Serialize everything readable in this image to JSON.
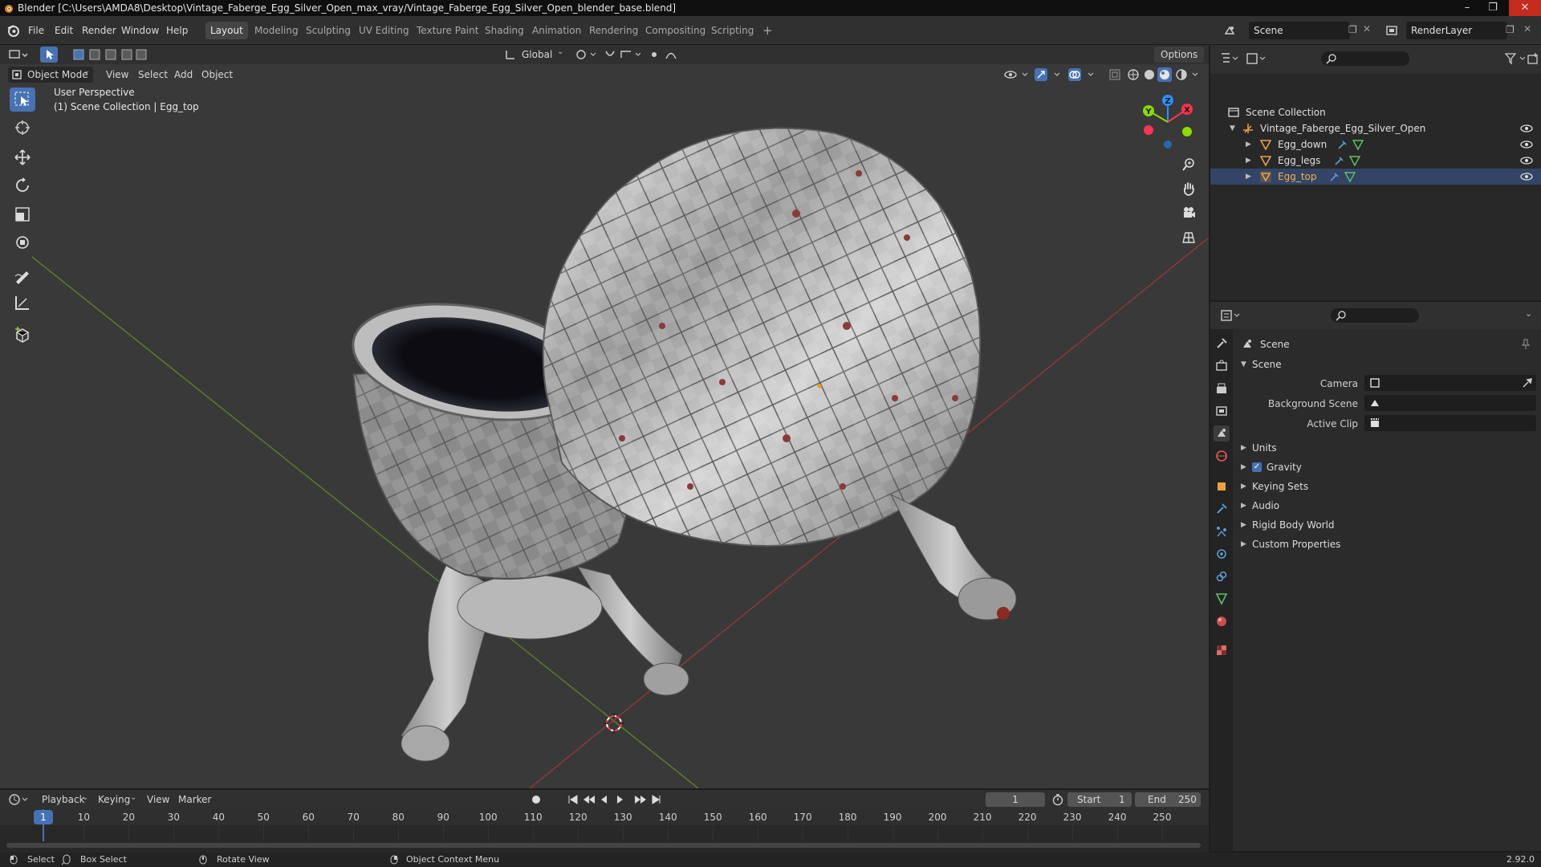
{
  "window": {
    "title": "Blender [C:\\Users\\AMDA8\\Desktop\\Vintage_Faberge_Egg_Silver_Open_max_vray/Vintage_Faberge_Egg_Silver_Open_blender_base.blend]"
  },
  "menu": [
    "File",
    "Edit",
    "Render",
    "Window",
    "Help"
  ],
  "workspaces": [
    {
      "label": "Layout",
      "active": true
    },
    {
      "label": "Modeling"
    },
    {
      "label": "Sculpting"
    },
    {
      "label": "UV Editing"
    },
    {
      "label": "Texture Paint"
    },
    {
      "label": "Shading"
    },
    {
      "label": "Animation"
    },
    {
      "label": "Rendering"
    },
    {
      "label": "Compositing"
    },
    {
      "label": "Scripting"
    }
  ],
  "add_workspace": "+",
  "scene_selector": {
    "value": "Scene"
  },
  "view_layer_selector": {
    "value": "RenderLayer"
  },
  "viewport": {
    "mode": "Object Mode",
    "menus": [
      "View",
      "Select",
      "Add",
      "Object"
    ],
    "transform_orientation": "Global",
    "options_label": "Options",
    "overlay_title": "User Perspective",
    "overlay_subtitle": "(1) Scene Collection | Egg_top",
    "gizmo_axes": {
      "x": "X",
      "y": "Y",
      "z": "Z"
    }
  },
  "outliner": {
    "root": "Scene Collection",
    "collection": "Vintage_Faberge_Egg_Silver_Open",
    "objects": [
      "Egg_down",
      "Egg_legs",
      "Egg_top"
    ]
  },
  "properties": {
    "context_title": "Scene",
    "panel_title": "Scene",
    "fields": [
      {
        "label": "Camera",
        "value": ""
      },
      {
        "label": "Background Scene",
        "value": ""
      },
      {
        "label": "Active Clip",
        "value": ""
      }
    ],
    "subpanels": [
      {
        "label": "Units"
      },
      {
        "label": "Gravity",
        "checkbox": true
      },
      {
        "label": "Keying Sets"
      },
      {
        "label": "Audio"
      },
      {
        "label": "Rigid Body World"
      },
      {
        "label": "Custom Properties"
      }
    ]
  },
  "timeline": {
    "menus": [
      "Playback",
      "Keying",
      "View",
      "Marker"
    ],
    "current_frame": "1",
    "start_label": "Start",
    "start_value": "1",
    "end_label": "End",
    "end_value": "250",
    "ticks": [
      "1",
      "10",
      "20",
      "30",
      "40",
      "50",
      "60",
      "70",
      "80",
      "90",
      "100",
      "110",
      "120",
      "130",
      "140",
      "150",
      "160",
      "170",
      "180",
      "190",
      "200",
      "210",
      "220",
      "230",
      "240",
      "250"
    ],
    "playhead_frame": 1
  },
  "statusbar": {
    "select": "Select",
    "box_select": "Box Select",
    "rotate": "Rotate View",
    "context_menu": "Object Context Menu",
    "version": "2.92.0"
  },
  "colors": {
    "accent": "#4772b3",
    "x_axis": "#ff3352",
    "y_axis": "#8bdc00",
    "z_axis": "#2890ff"
  }
}
